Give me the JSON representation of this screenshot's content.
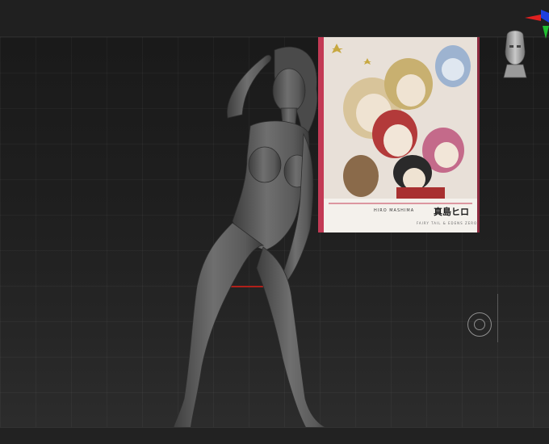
{
  "app": {
    "top_shelf": "",
    "bottom_shelf": ""
  },
  "viewport": {
    "model": "sculpt-figure",
    "floor_line_color": "#b0201a"
  },
  "reference_image": {
    "author_latin": "HIRO MASHIMA",
    "author_japanese": "真島ヒロ",
    "subtitle": "FAIRY TAIL & EDENS ZERO",
    "frame_color": "#c33a55"
  },
  "navigation": {
    "axis_gizmo_icon": "xyz-axis-icon",
    "head_gizmo_icon": "head-orientation-icon",
    "orbit_icon": "orbit-target-icon",
    "axis_colors": {
      "x": "#e02020",
      "y": "#20c030",
      "z": "#2040e0"
    }
  }
}
